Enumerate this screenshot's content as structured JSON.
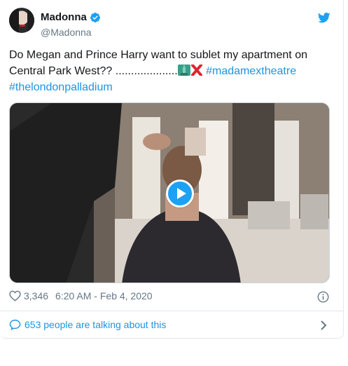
{
  "tweet": {
    "author_name": "Madonna",
    "handle": "@Madonna",
    "text_part1": "Do Megan and Prince Harry want to sublet my apartment on Central Park West?? ....................",
    "hashtag1": "#madamextheatre",
    "hashtag2": "#thelondonpalladium",
    "likes": "3,346",
    "timestamp": "6:20 AM - Feb 4, 2020",
    "talking": "653 people are talking about this"
  },
  "colors": {
    "twitter_blue": "#1da1f2",
    "link_blue": "#1b95e0",
    "secondary_text": "#657786"
  },
  "icons": [
    "verified-badge-icon",
    "twitter-bird-icon",
    "statue-of-liberty-emoji-icon",
    "cross-mark-emoji-icon",
    "play-icon",
    "heart-icon",
    "info-icon",
    "speech-bubble-icon",
    "chevron-right-icon"
  ]
}
